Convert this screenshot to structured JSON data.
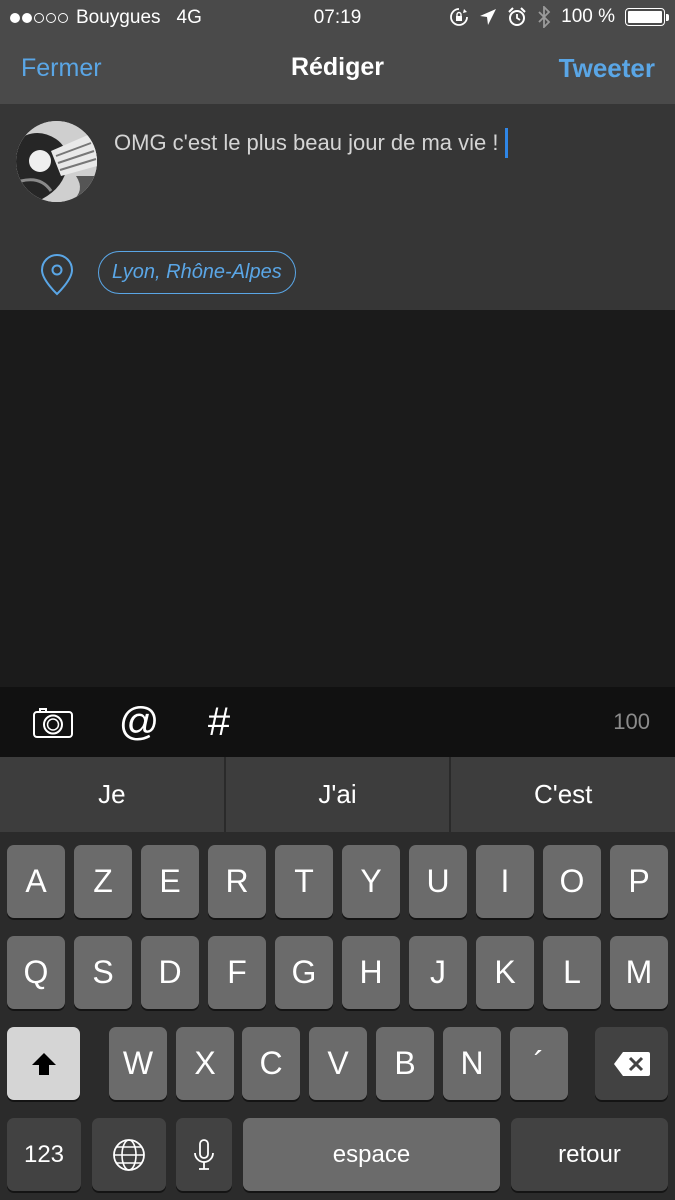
{
  "status": {
    "carrier": "Bouygues",
    "network": "4G",
    "time": "07:19",
    "battery_label": "100 %",
    "signal_dots": [
      true,
      true,
      false,
      false,
      false
    ]
  },
  "nav": {
    "close_label": "Fermer",
    "title": "Rédiger",
    "tweet_label": "Tweeter"
  },
  "compose": {
    "text": "OMG c'est le plus beau jour de ma vie !",
    "location": "Lyon, Rhône-Alpes"
  },
  "toolbar": {
    "at_symbol": "@",
    "hash_symbol": "#",
    "char_count": "100"
  },
  "predictions": [
    "Je",
    "J'ai",
    "C'est"
  ],
  "keyboard": {
    "row1": [
      "A",
      "Z",
      "E",
      "R",
      "T",
      "Y",
      "U",
      "I",
      "O",
      "P"
    ],
    "row2": [
      "Q",
      "S",
      "D",
      "F",
      "G",
      "H",
      "J",
      "K",
      "L",
      "M"
    ],
    "row3": [
      "W",
      "X",
      "C",
      "V",
      "B",
      "N",
      "´"
    ],
    "numbers_label": "123",
    "space_label": "espace",
    "return_label": "retour"
  },
  "colors": {
    "accent": "#5aa6e6",
    "cursor": "#2f86e6",
    "nav_background": "#4a4a4a",
    "compose_background": "#363636"
  },
  "icons": [
    "lock-rotation-icon",
    "location-arrow-icon",
    "alarm-icon",
    "bluetooth-icon",
    "battery-icon",
    "location-pin-icon",
    "camera-icon",
    "globe-icon",
    "microphone-icon",
    "shift-icon",
    "backspace-icon"
  ]
}
